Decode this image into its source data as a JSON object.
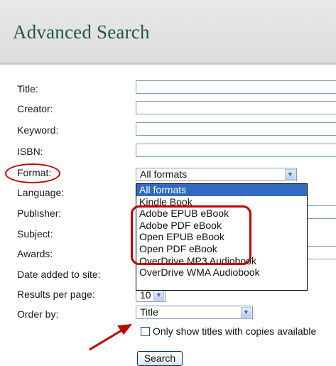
{
  "header": {
    "title": "Advanced Search"
  },
  "labels": {
    "title": "Title:",
    "creator": "Creator:",
    "keyword": "Keyword:",
    "isbn": "ISBN:",
    "format": "Format:",
    "language": "Language:",
    "publisher": "Publisher:",
    "subject": "Subject:",
    "awards": "Awards:",
    "date_added": "Date added to site:",
    "results_per_page": "Results per page:",
    "order_by": "Order by:"
  },
  "format_select": {
    "value": "All formats",
    "options": [
      "All formats",
      "Kindle Book",
      "Adobe EPUB eBook",
      "Adobe PDF eBook",
      "Open EPUB eBook",
      "Open PDF eBook",
      "OverDrive MP3 Audiobook",
      "OverDrive WMA Audiobook"
    ]
  },
  "results_per_page_select": {
    "value": "10"
  },
  "order_by_select": {
    "value": "Title"
  },
  "copies_checkbox": {
    "label": "Only show titles with copies available",
    "checked": false
  },
  "search_button": {
    "label": "Search"
  },
  "annotation_color": "#c00000",
  "highlight_color": "#316ac5"
}
